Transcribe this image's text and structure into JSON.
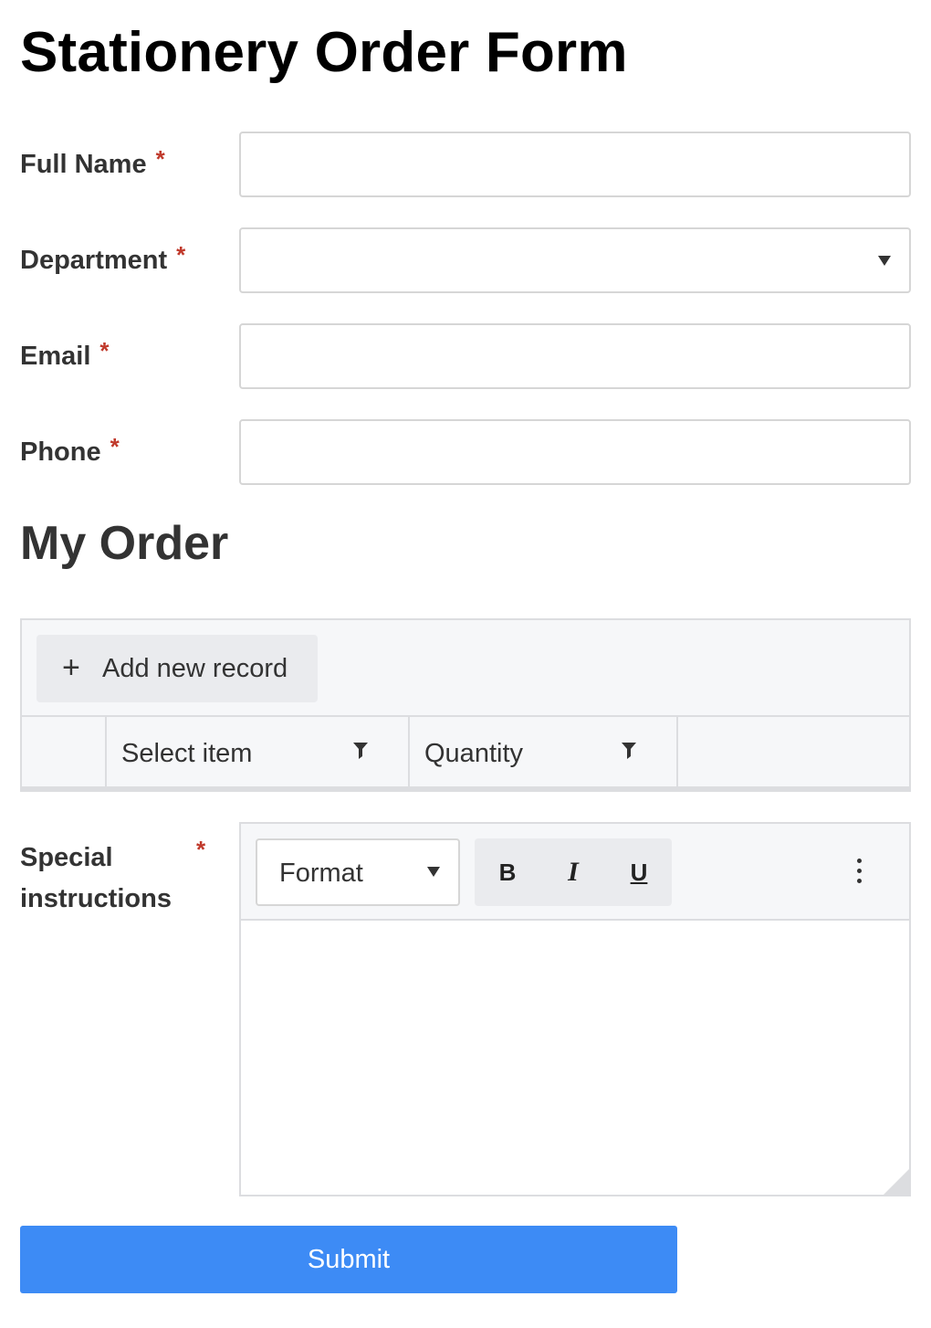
{
  "page_title": "Stationery Order Form",
  "required_marker": "*",
  "fields": {
    "full_name": {
      "label": "Full Name",
      "value": ""
    },
    "department": {
      "label": "Department",
      "selected": ""
    },
    "email": {
      "label": "Email",
      "value": ""
    },
    "phone": {
      "label": "Phone",
      "value": ""
    }
  },
  "order_section": {
    "title": "My Order",
    "add_button": {
      "icon": "plus-icon",
      "label": "Add new record"
    },
    "columns": [
      {
        "label": ""
      },
      {
        "label": "Select item",
        "icon": "filter-icon"
      },
      {
        "label": "Quantity",
        "icon": "filter-icon"
      },
      {
        "label": ""
      }
    ]
  },
  "special_instructions": {
    "label_line1": "Special",
    "label_line2": "instructions",
    "toolbar": {
      "format_label": "Format",
      "bold": "B",
      "italic": "I",
      "underline": "U",
      "more_icon": "more-vertical-icon"
    },
    "content": ""
  },
  "submit_label": "Submit",
  "colors": {
    "accent": "#3d8bf5",
    "required": "#c0392b",
    "border": "#d6d6d6",
    "toolbar_bg": "#f6f7f9"
  }
}
